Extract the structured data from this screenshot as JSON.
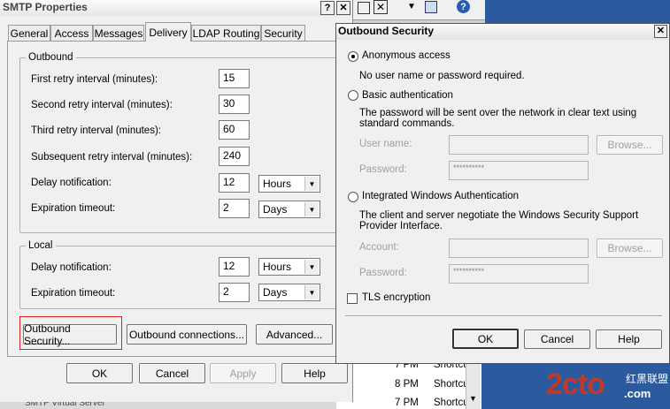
{
  "smtp": {
    "title": "SMTP Properties",
    "tabs": [
      "General",
      "Access",
      "Messages",
      "Delivery",
      "LDAP Routing",
      "Security"
    ],
    "outbound": {
      "group_title": "Outbound",
      "first_retry_label": "First retry interval (minutes):",
      "first_retry_value": "15",
      "second_retry_label": "Second retry interval (minutes):",
      "second_retry_value": "30",
      "third_retry_label": "Third retry interval (minutes):",
      "third_retry_value": "60",
      "subsequent_retry_label": "Subsequent retry interval (minutes):",
      "subsequent_retry_value": "240",
      "delay_label": "Delay notification:",
      "delay_value": "12",
      "delay_unit": "Hours",
      "expiration_label": "Expiration timeout:",
      "expiration_value": "2",
      "expiration_unit": "Days"
    },
    "local": {
      "group_title": "Local",
      "delay_label": "Delay notification:",
      "delay_value": "12",
      "delay_unit": "Hours",
      "expiration_label": "Expiration timeout:",
      "expiration_value": "2",
      "expiration_unit": "Days"
    },
    "buttons": {
      "outbound_security": "Outbound Security...",
      "outbound_connections": "Outbound connections...",
      "advanced": "Advanced...",
      "ok": "OK",
      "cancel": "Cancel",
      "apply": "Apply",
      "help": "Help"
    }
  },
  "outbound_security": {
    "title": "Outbound Security",
    "anonymous_label": "Anonymous access",
    "anonymous_desc": "No user name or password required.",
    "basic_label": "Basic authentication",
    "basic_desc": "The password will be sent over the network in clear text using standard commands.",
    "user_name_label": "User name:",
    "password_label": "Password:",
    "password_mask": "**********",
    "browse_label": "Browse...",
    "integrated_label": "Integrated Windows Authentication",
    "integrated_desc": "The client and server negotiate the Windows Security Support Provider Interface.",
    "account_label": "Account:",
    "account_password_label": "Password:",
    "account_password_mask": "**********",
    "account_browse_label": "Browse...",
    "tls_label": "TLS encryption",
    "ok": "OK",
    "cancel": "Cancel",
    "help": "Help"
  },
  "background": {
    "times": [
      "7 PM",
      "8 PM",
      "7 PM"
    ],
    "items": [
      "Shortcu",
      "Shortcu",
      "Shortcu"
    ],
    "partial_text": "SMTP Virtual Server"
  },
  "watermark": {
    "logo": "2cto",
    "suffix": ".com",
    "cn_text": "红黑联盟"
  },
  "accent_colors": {
    "highlight_box": "#e02020",
    "selected_row": "#3399ff",
    "watermark": "#c0392b"
  }
}
